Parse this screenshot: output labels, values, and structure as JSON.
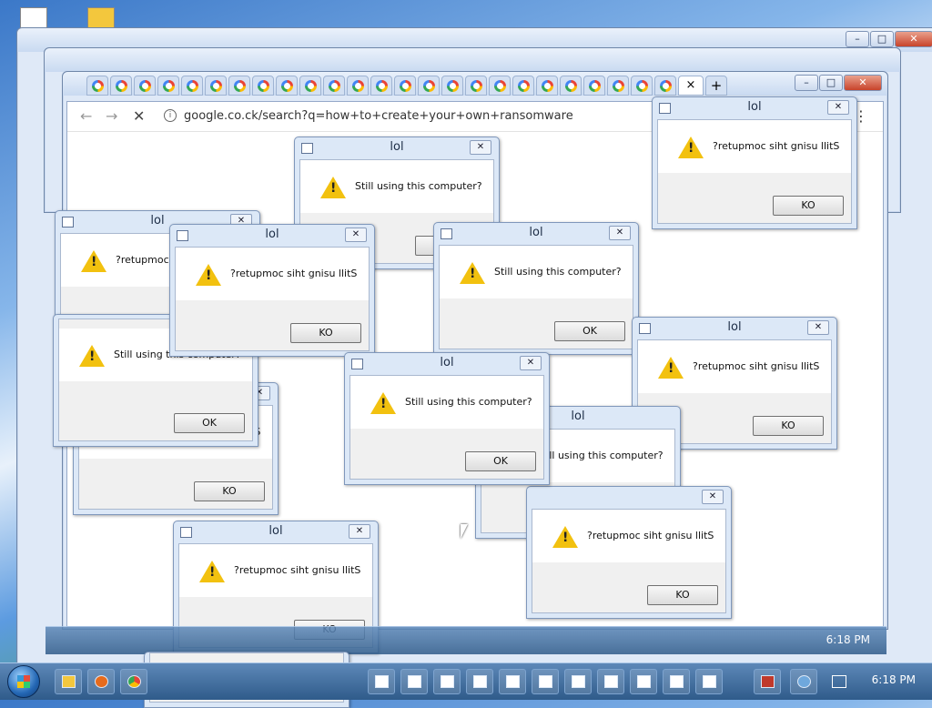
{
  "browser": {
    "url": "google.co.ck/search?q=how+to+create+your+own+ransomware",
    "tab_close": "×",
    "new_tab": "+",
    "minimize": "–",
    "maximize": "□",
    "close": "✕",
    "menu": "⋮"
  },
  "dialog_title": "lol",
  "messages": {
    "normal": "Still using this computer?",
    "reversed": "?retupmoc siht gnisu llitS"
  },
  "buttons": {
    "ok": "OK",
    "ko": "KO"
  },
  "taskbar": {
    "clock_front": "6:18 PM",
    "clock_back": "6:18 PM"
  },
  "dialogs": [
    {
      "text": "normal",
      "button": "ok"
    },
    {
      "text": "reversed",
      "button": "ko"
    },
    {
      "text": "reversed",
      "button": "ko"
    },
    {
      "text": "reversed",
      "button": "ko"
    },
    {
      "text": "normal",
      "button": "ok"
    },
    {
      "text": "normal",
      "button": "ok"
    },
    {
      "text": "reversed",
      "button": "ko"
    },
    {
      "text": "normal",
      "button": "ok"
    },
    {
      "text": "normal",
      "button": "ok"
    },
    {
      "text": "reversed",
      "button": "ko"
    },
    {
      "text": "reversed",
      "button": "ko"
    },
    {
      "text": "reversed",
      "button": "ko"
    }
  ],
  "colors": {
    "warning": "#f2c10f",
    "taskbar": "#2f5b8a"
  }
}
